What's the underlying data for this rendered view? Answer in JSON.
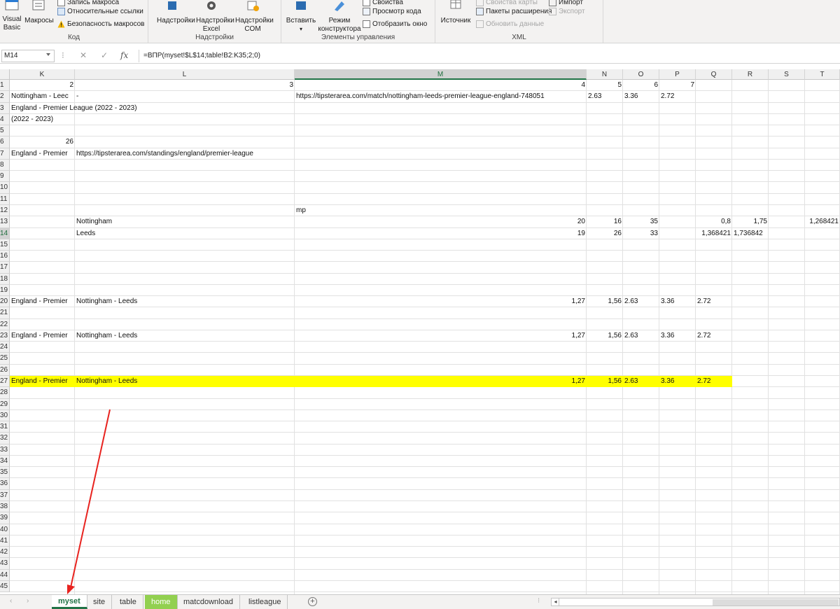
{
  "ribbon": {
    "code_group": {
      "label": "Код",
      "visual_basic": "Visual Basic",
      "macros": "Макросы",
      "record_macro": "Запись макроса",
      "relative_refs": "Относительные ссылки",
      "macro_security": "Безопасность макросов"
    },
    "addins_group": {
      "label": "Надстройки",
      "addins": "Надстройки",
      "excel_addins": "Надстройки Excel",
      "com_addins": "Надстройки COM"
    },
    "controls_group": {
      "label": "Элементы управления",
      "insert": "Вставить",
      "design_mode": "Режим конструктора",
      "properties": "Свойства",
      "view_code": "Просмотр кода",
      "run_dialog": "Отобразить окно"
    },
    "xml_group": {
      "label": "XML",
      "source": "Источник",
      "map_properties": "Свойства карты",
      "expansion_packs": "Пакеты расширения",
      "refresh_data": "Обновить данные",
      "import": "Импорт",
      "export": "Экспорт"
    }
  },
  "formula_bar": {
    "name_box": "M14",
    "fx": "fx",
    "cancel": "✕",
    "enter": "✓",
    "formula": "=ВПР(myset!$L$14;table!B2:K35;2;0)"
  },
  "grid": {
    "columns": [
      "K",
      "L",
      "M",
      "N",
      "O",
      "P",
      "Q",
      "R",
      "S",
      "T"
    ],
    "selected_column": "M",
    "selected_row": "14",
    "rows": [
      "1",
      "2",
      "3",
      "4",
      "5",
      "6",
      "7",
      "8",
      "9",
      "10",
      "11",
      "12",
      "13",
      "14",
      "15",
      "16",
      "17",
      "18",
      "19",
      "20",
      "21",
      "22",
      "23",
      "24",
      "25",
      "26",
      "27",
      "28",
      "29",
      "30",
      "31",
      "32",
      "33",
      "34",
      "35",
      "36",
      "37",
      "38",
      "39",
      "40",
      "41",
      "42",
      "43",
      "44",
      "45"
    ],
    "cells": [
      {
        "r": 1,
        "c": "K",
        "v": "2",
        "num": true
      },
      {
        "r": 1,
        "c": "L",
        "v": "3",
        "num": true
      },
      {
        "r": 1,
        "c": "M",
        "v": "4",
        "num": true
      },
      {
        "r": 1,
        "c": "N",
        "v": "5",
        "num": true
      },
      {
        "r": 1,
        "c": "O",
        "v": "6",
        "num": true
      },
      {
        "r": 1,
        "c": "P",
        "v": "7",
        "num": true
      },
      {
        "r": 2,
        "c": "K",
        "v": "Nottingham - Leec"
      },
      {
        "r": 2,
        "c": "L",
        "v": "-"
      },
      {
        "r": 2,
        "c": "M",
        "v": "https://tipsterarea.com/match/nottingham-leeds-premier-league-england-748051"
      },
      {
        "r": 2,
        "c": "N",
        "v": "2.63"
      },
      {
        "r": 2,
        "c": "O",
        "v": "3.36"
      },
      {
        "r": 2,
        "c": "P",
        "v": "2.72"
      },
      {
        "r": 3,
        "c": "K",
        "v": "England - Premier League (2022 - 2023)"
      },
      {
        "r": 4,
        "c": "K",
        "v": "(2022 - 2023)"
      },
      {
        "r": 6,
        "c": "K",
        "v": "26",
        "num": true
      },
      {
        "r": 7,
        "c": "K",
        "v": "England - Premier"
      },
      {
        "r": 7,
        "c": "L",
        "v": "https://tipsterarea.com/standings/england/premier-league"
      },
      {
        "r": 12,
        "c": "M",
        "v": "mp"
      },
      {
        "r": 13,
        "c": "L",
        "v": "Nottingham"
      },
      {
        "r": 13,
        "c": "M",
        "v": "20",
        "num": true
      },
      {
        "r": 13,
        "c": "N",
        "v": "16",
        "num": true
      },
      {
        "r": 13,
        "c": "O",
        "v": "35",
        "num": true
      },
      {
        "r": 13,
        "c": "Q",
        "v": "0,8",
        "num": true
      },
      {
        "r": 13,
        "c": "R",
        "v": "1,75",
        "num": true
      },
      {
        "r": 13,
        "c": "T",
        "v": "1,268421",
        "num": true
      },
      {
        "r": 14,
        "c": "L",
        "v": "Leeds"
      },
      {
        "r": 14,
        "c": "M",
        "v": "19",
        "num": true
      },
      {
        "r": 14,
        "c": "N",
        "v": "26",
        "num": true
      },
      {
        "r": 14,
        "c": "O",
        "v": "33",
        "num": true
      },
      {
        "r": 14,
        "c": "Q",
        "v": "1,368421",
        "num": true
      },
      {
        "r": 14,
        "c": "R",
        "v": "1,736842"
      },
      {
        "r": 20,
        "c": "K",
        "v": "England - Premier"
      },
      {
        "r": 20,
        "c": "L",
        "v": "Nottingham - Leeds"
      },
      {
        "r": 20,
        "c": "M",
        "v": "1,27",
        "num": true
      },
      {
        "r": 20,
        "c": "N",
        "v": "1,56",
        "num": true
      },
      {
        "r": 20,
        "c": "O",
        "v": "2.63"
      },
      {
        "r": 20,
        "c": "P",
        "v": "3.36"
      },
      {
        "r": 20,
        "c": "Q",
        "v": "2.72"
      },
      {
        "r": 23,
        "c": "K",
        "v": "England - Premier"
      },
      {
        "r": 23,
        "c": "L",
        "v": "Nottingham - Leeds"
      },
      {
        "r": 23,
        "c": "M",
        "v": "1,27",
        "num": true
      },
      {
        "r": 23,
        "c": "N",
        "v": "1,56",
        "num": true
      },
      {
        "r": 23,
        "c": "O",
        "v": "2.63"
      },
      {
        "r": 23,
        "c": "P",
        "v": "3.36"
      },
      {
        "r": 23,
        "c": "Q",
        "v": "2.72"
      },
      {
        "r": 27,
        "c": "K",
        "v": "England - Premier"
      },
      {
        "r": 27,
        "c": "L",
        "v": "Nottingham - Leeds"
      },
      {
        "r": 27,
        "c": "M",
        "v": "1,27",
        "num": true
      },
      {
        "r": 27,
        "c": "N",
        "v": "1,56",
        "num": true
      },
      {
        "r": 27,
        "c": "O",
        "v": "2.63"
      },
      {
        "r": 27,
        "c": "P",
        "v": "3.36"
      },
      {
        "r": 27,
        "c": "Q",
        "v": "2.72"
      }
    ],
    "highlight_row": 27,
    "highlight_color": "#ffff00"
  },
  "sheet_tabs": {
    "tabs": [
      "myset",
      "site",
      "table",
      "home",
      "matcdownload",
      "listleague"
    ],
    "active": "myset",
    "green_tab": "home",
    "add_label": "+"
  },
  "annotation_color": "#e8231f",
  "accent_color": "#217346"
}
